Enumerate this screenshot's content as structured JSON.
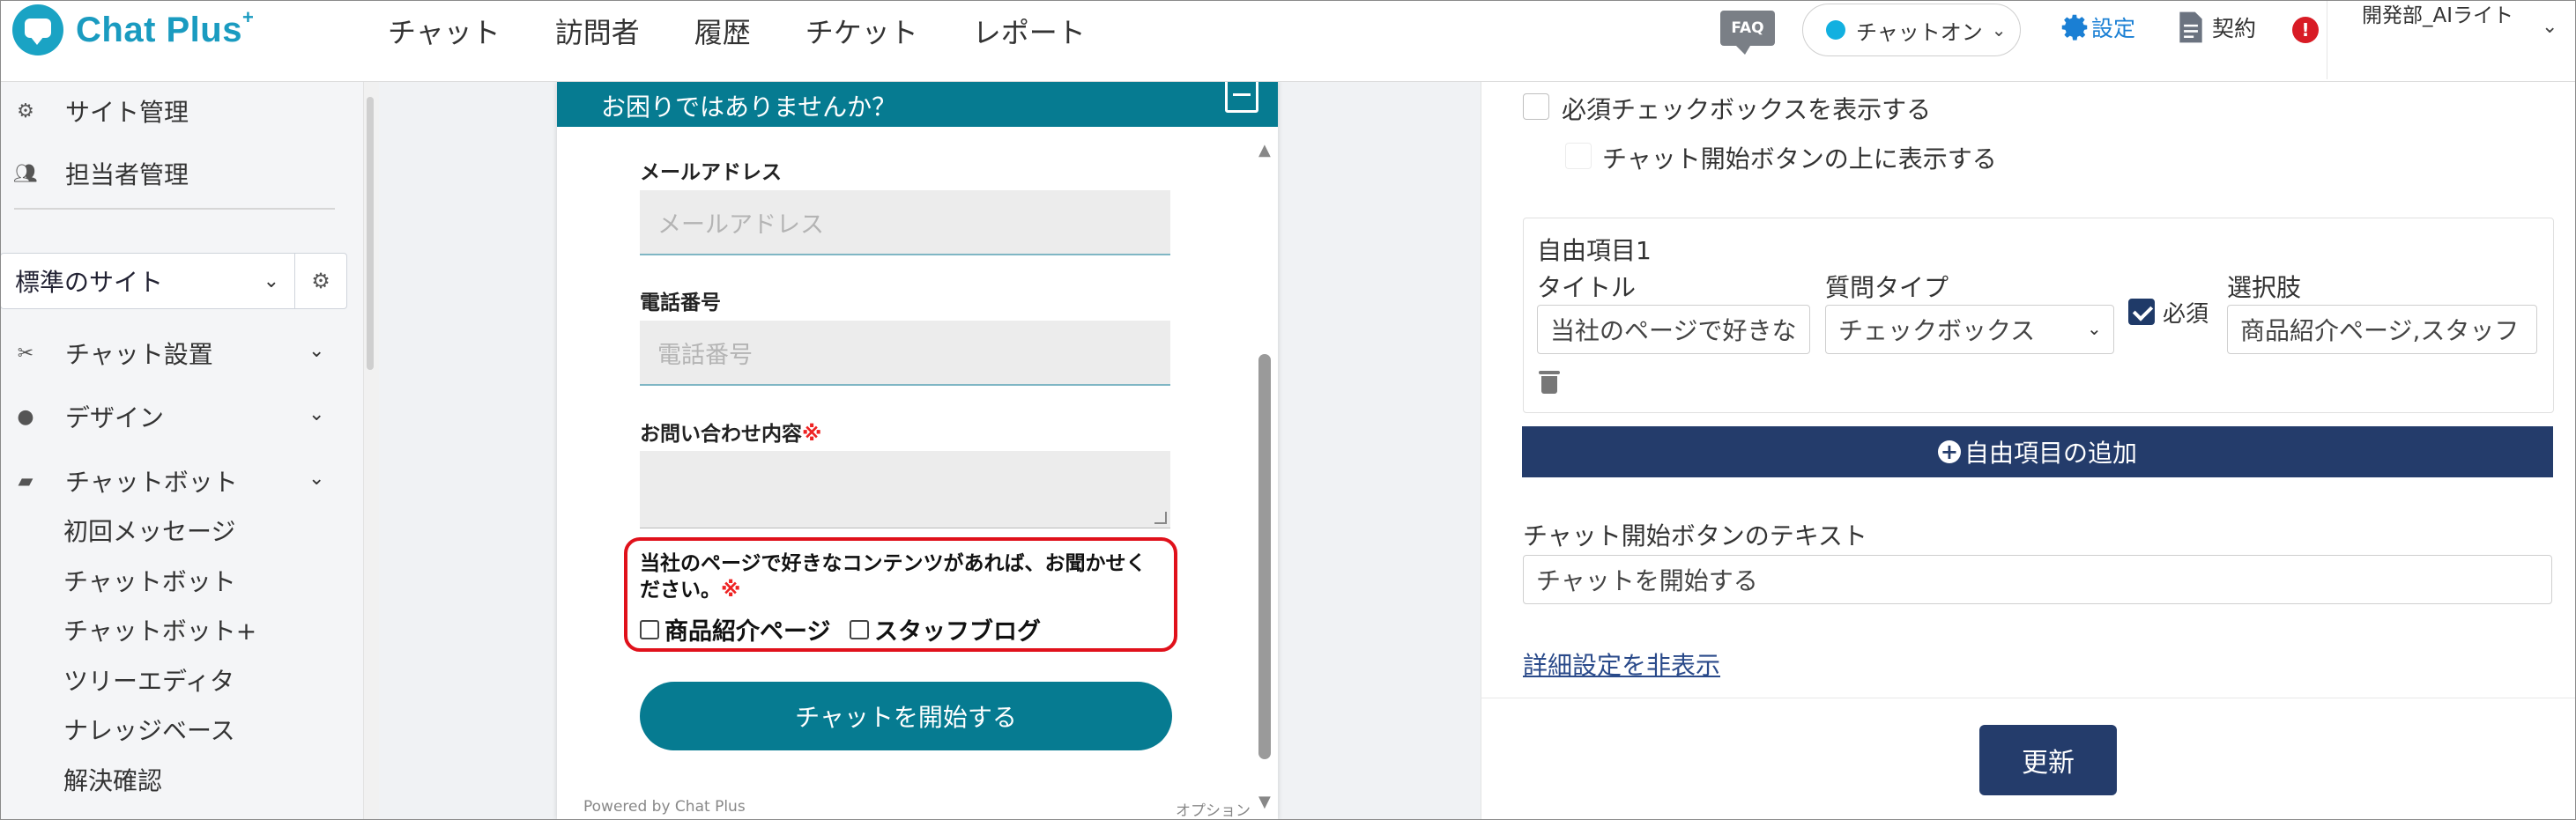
{
  "brand": {
    "name": "Chat Plus",
    "sup": "+"
  },
  "nav": [
    "チャット",
    "訪問者",
    "履歴",
    "チケット",
    "レポート"
  ],
  "header_right": {
    "faq": "FAQ",
    "status": "チャットオン",
    "settings": "設定",
    "contract": "契約",
    "alert": "!",
    "user": "開発部_AIライト"
  },
  "sidebar": {
    "top_items": [
      {
        "label": "サイト管理",
        "icon": "gear-icon"
      },
      {
        "label": "担当者管理",
        "icon": "users-icon"
      }
    ],
    "site_select": "標準のサイト",
    "sections": [
      {
        "label": "チャット設置",
        "icon": "tools-icon"
      },
      {
        "label": "デザイン",
        "icon": "palette-icon"
      },
      {
        "label": "チャットボット",
        "icon": "chat-icon"
      }
    ],
    "sub_items": [
      "初回メッセージ",
      "チャットボット",
      "チャットボット+",
      "ツリーエディタ",
      "ナレッジベース",
      "解決確認"
    ]
  },
  "widget": {
    "title": "お困りではありませんか？",
    "email_label": "メールアドレス",
    "email_placeholder": "メールアドレス",
    "phone_label": "電話番号",
    "phone_placeholder": "電話番号",
    "inquiry_label": "お問い合わせ内容",
    "required_mark": "※",
    "question_line1": "当社のページで好きなコンテンツがあれば、お聞かせく",
    "question_line2": "ださい。",
    "options": [
      "商品紹介ページ",
      "スタッフブログ"
    ],
    "start_button": "チャットを開始する",
    "powered": "Powered by Chat Plus",
    "option_text": "オプション"
  },
  "settings": {
    "required_checkbox_label": "必須チェックボックスを表示する",
    "above_start_label": "チャット開始ボタンの上に表示する",
    "free_item": {
      "heading": "自由項目1",
      "title_label": "タイトル",
      "title_value": "当社のページで好きな",
      "type_label": "質問タイプ",
      "type_value": "チェックボックス",
      "required_label": "必須",
      "choices_label": "選択肢",
      "choices_value": "商品紹介ページ,スタッフ"
    },
    "add_free_item": "自由項目の追加",
    "start_text_label": "チャット開始ボタンのテキスト",
    "start_text_value": "チャットを開始する",
    "hide_advanced": "詳細設定を非表示",
    "update_button": "更新"
  },
  "colors": {
    "brand": "#1a9bc0",
    "widget_teal": "#067b91",
    "navy": "#243c6b",
    "highlight": "#e0111b"
  }
}
